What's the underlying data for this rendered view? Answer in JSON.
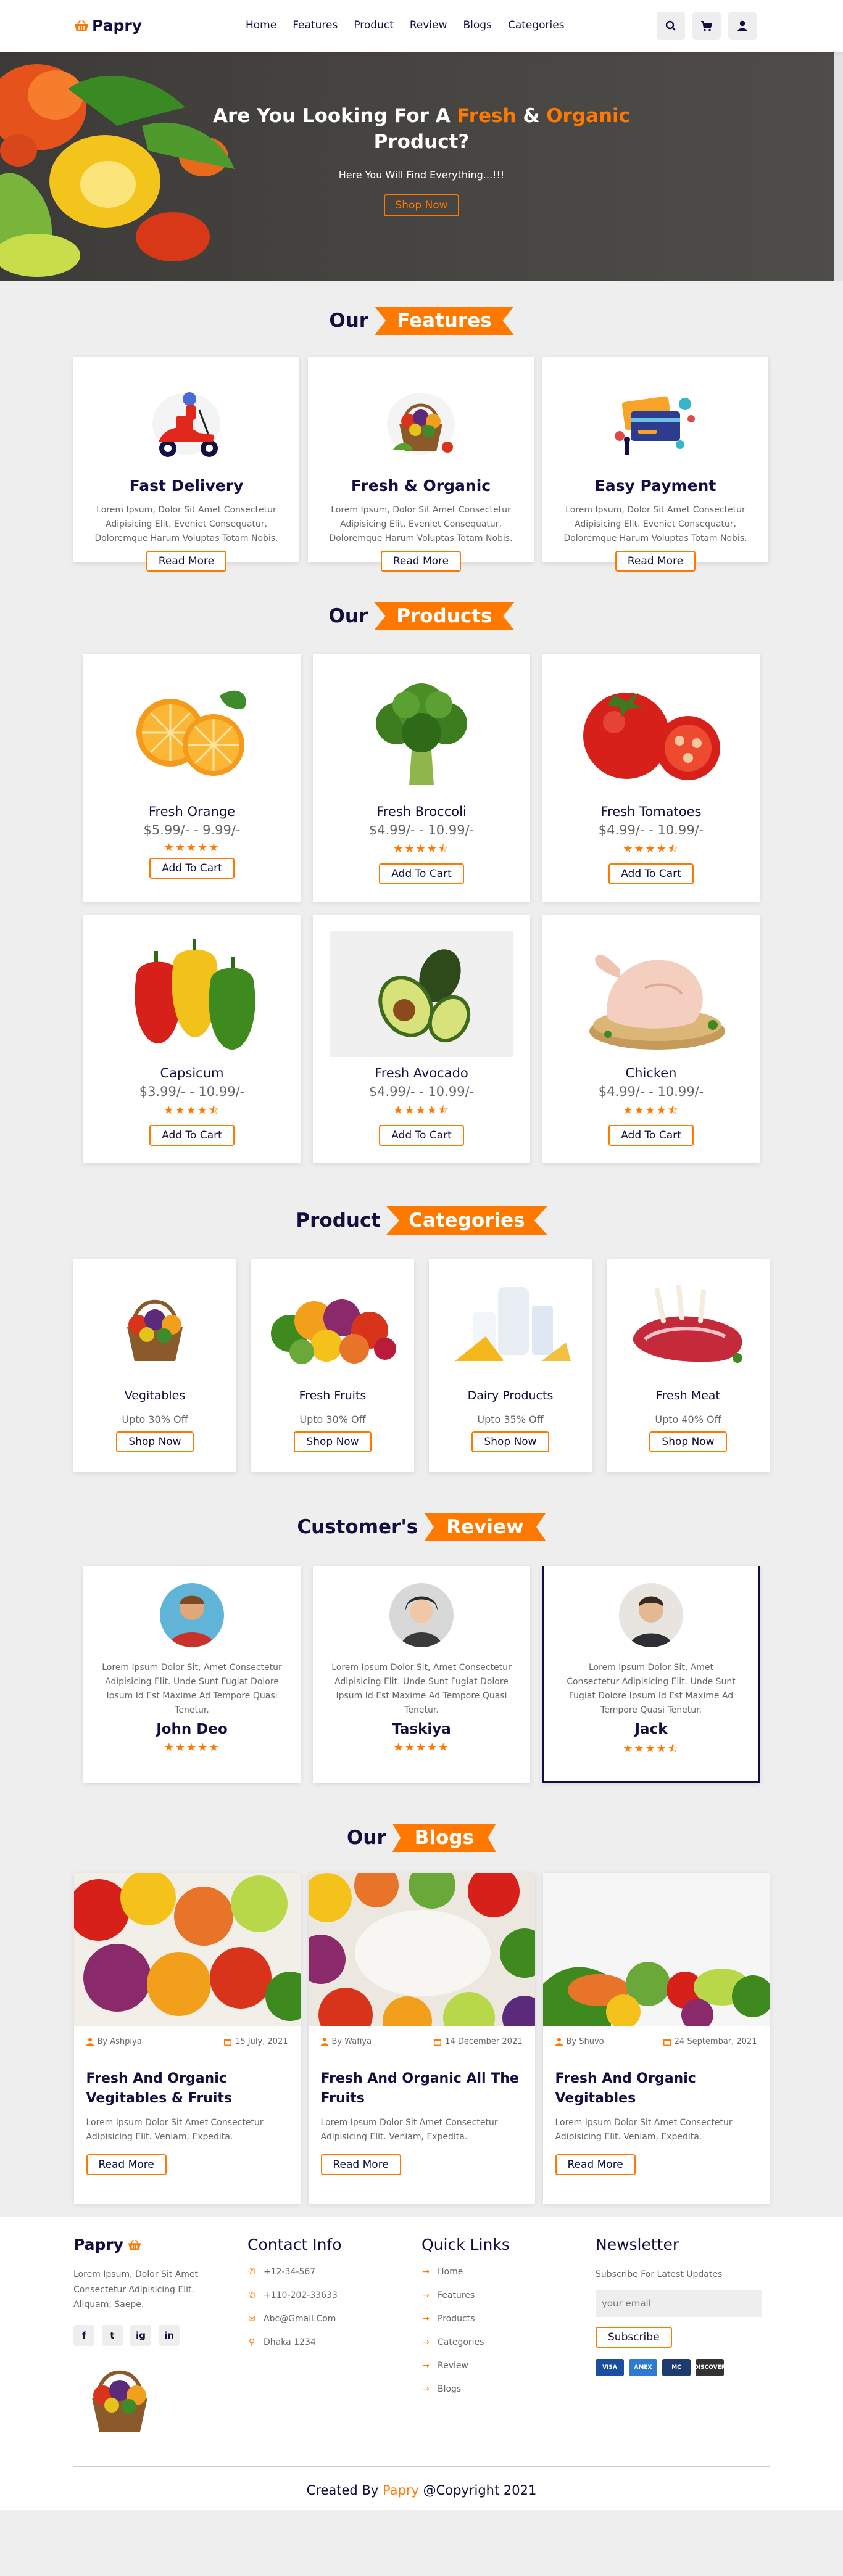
{
  "brand": {
    "name": "Papry",
    "logo_icon": "basket-icon"
  },
  "nav": [
    "Home",
    "Features",
    "Product",
    "Review",
    "Blogs",
    "Categories"
  ],
  "header_icons": [
    "search-icon",
    "cart-icon",
    "user-icon"
  ],
  "hero": {
    "title_pre": "Are You Looking For A ",
    "title_fresh": "Fresh",
    "title_and": " & ",
    "title_organic": "Organic",
    "title_l2": "Product?",
    "subtitle": "Here You Will Find Everything...!!!",
    "button": "Shop Now"
  },
  "features": {
    "heading_a": "Our",
    "heading_b": "Features",
    "items": [
      {
        "title": "Fast Delivery",
        "text": "Lorem Ipsum, Dolor Sit Amet Consectetur Adipisicing Elit. Eveniet Consequatur, Doloremque Harum Voluptas Totam Nobis.",
        "button": "Read More"
      },
      {
        "title": "Fresh & Organic",
        "text": "Lorem Ipsum, Dolor Sit Amet Consectetur Adipisicing Elit. Eveniet Consequatur, Doloremque Harum Voluptas Totam Nobis.",
        "button": "Read More"
      },
      {
        "title": "Easy Payment",
        "text": "Lorem Ipsum, Dolor Sit Amet Consectetur Adipisicing Elit. Eveniet Consequatur, Doloremque Harum Voluptas Totam Nobis.",
        "button": "Read More"
      }
    ]
  },
  "products": {
    "heading_a": "Our",
    "heading_b": "Products",
    "items": [
      {
        "name": "Fresh Orange",
        "price": "$5.99/- - 9.99/-",
        "stars": "★★★★★",
        "button": "Add To Cart"
      },
      {
        "name": "Fresh Broccoli",
        "price": "$4.99/- - 10.99/-",
        "stars": "★★★★⯪",
        "button": "Add To Cart"
      },
      {
        "name": "Fresh Tomatoes",
        "price": "$4.99/- - 10.99/-",
        "stars": "★★★★⯪",
        "button": "Add To Cart"
      },
      {
        "name": "Capsicum",
        "price": "$3.99/- - 10.99/-",
        "stars": "★★★★⯪",
        "button": "Add To Cart"
      },
      {
        "name": "Fresh Avocado",
        "price": "$4.99/- - 10.99/-",
        "stars": "★★★★⯪",
        "button": "Add To Cart"
      },
      {
        "name": "Chicken",
        "price": "$4.99/- - 10.99/-",
        "stars": "★★★★⯪",
        "button": "Add To Cart"
      }
    ]
  },
  "categories": {
    "heading_a": "Product",
    "heading_b": "Categories",
    "items": [
      {
        "name": "Vegitables",
        "offer": "Upto 30% Off",
        "button": "Shop Now"
      },
      {
        "name": "Fresh Fruits",
        "offer": "Upto 30% Off",
        "button": "Shop Now"
      },
      {
        "name": "Dairy Products",
        "offer": "Upto 35% Off",
        "button": "Shop Now"
      },
      {
        "name": "Fresh Meat",
        "offer": "Upto 40% Off",
        "button": "Shop Now"
      }
    ]
  },
  "reviews": {
    "heading_a": "Customer's",
    "heading_b": "Review",
    "items": [
      {
        "name": "John Deo",
        "text": "Lorem Ipsum Dolor Sit, Amet Consectetur Adipisicing Elit. Unde Sunt Fugiat Dolore Ipsum Id Est Maxime Ad Tempore Quasi Tenetur.",
        "stars": "★★★★★"
      },
      {
        "name": "Taskiya",
        "text": "Lorem Ipsum Dolor Sit, Amet Consectetur Adipisicing Elit. Unde Sunt Fugiat Dolore Ipsum Id Est Maxime Ad Tempore Quasi Tenetur.",
        "stars": "★★★★★"
      },
      {
        "name": "Jack",
        "text": "Lorem Ipsum Dolor Sit, Amet Consectetur Adipisicing Elit. Unde Sunt Fugiat Dolore Ipsum Id Est Maxime Ad Tempore Quasi Tenetur.",
        "stars": "★★★★⯪"
      }
    ]
  },
  "blogs": {
    "heading_a": "Our",
    "heading_b": "Blogs",
    "items": [
      {
        "author": "By Ashpiya",
        "date": "15 July, 2021",
        "title": "Fresh And Organic Vegitables & Fruits",
        "text": "Lorem Ipsum Dolor Sit Amet Consectetur Adipisicing Elit. Veniam, Expedita.",
        "button": "Read More"
      },
      {
        "author": "By Wafiya",
        "date": "14 December 2021",
        "title": "Fresh And Organic All The Fruits",
        "text": "Lorem Ipsum Dolor Sit Amet Consectetur Adipisicing Elit. Veniam, Expedita.",
        "button": "Read More"
      },
      {
        "author": "By Shuvo",
        "date": "24 Septembar, 2021",
        "title": "Fresh And Organic Vegitables",
        "text": "Lorem Ipsum Dolor Sit Amet Consectetur Adipisicing Elit. Veniam, Expedita.",
        "button": "Read More"
      }
    ]
  },
  "footer": {
    "brand": "Papry",
    "about": "Lorem Ipsum, Dolor Sit Amet Consectetur Adipisicing Elit. Aliquam, Saepe.",
    "social": [
      "f",
      "t",
      "ig",
      "in"
    ],
    "contact_title": "Contact Info",
    "contact": [
      "+12-34-567",
      "+110-202-33633",
      "Abc@Gmail.Com",
      "Dhaka 1234"
    ],
    "links_title": "Quick Links",
    "links": [
      "Home",
      "Features",
      "Products",
      "Categories",
      "Review",
      "Blogs"
    ],
    "newsletter_title": "Newsletter",
    "newsletter_text": "Subscribe For Latest Updates",
    "email_placeholder": "your email",
    "subscribe": "Subscribe",
    "payments": [
      "VISA",
      "AMEX",
      "MC",
      "DISCOVER"
    ],
    "credit_a": "Created By ",
    "credit_b": "Papry",
    "credit_c": " @Copyright 2021"
  },
  "colors": {
    "accent": "#ff7800",
    "dark": "#130f40",
    "bg": "#eeeeee"
  }
}
